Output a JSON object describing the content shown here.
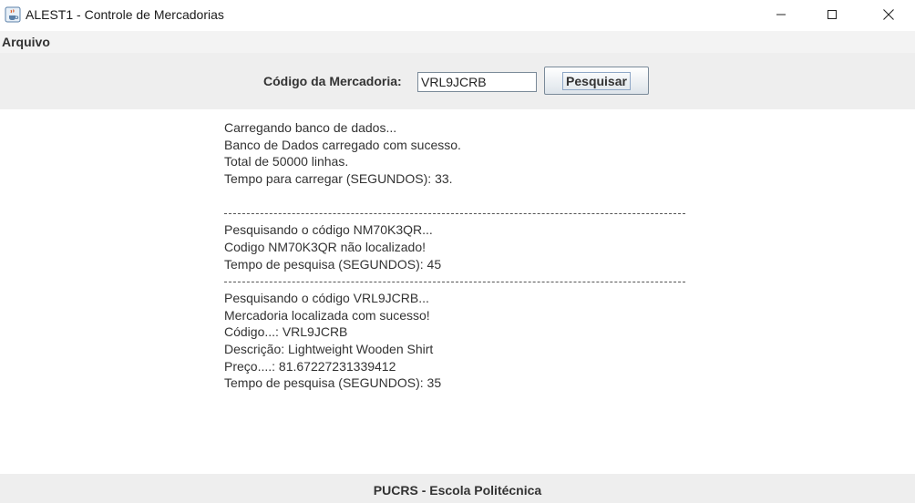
{
  "window": {
    "title": "ALEST1 - Controle de Mercadorias",
    "app_icon": "java-cup-icon"
  },
  "menu": {
    "items": [
      {
        "label": "Arquivo"
      }
    ]
  },
  "search": {
    "label": "Código da Mercadoria:",
    "value": "VRL9JCRB",
    "button_label": "Pesquisar"
  },
  "output": {
    "lines": [
      "Carregando banco de dados...",
      "Banco de Dados carregado com sucesso.",
      "Total de 50000 linhas.",
      "Tempo para carregar (SEGUNDOS): 33.",
      "Pesquisando o código NM70K3QR...",
      "Codigo NM70K3QR não localizado!",
      "Tempo de pesquisa (SEGUNDOS): 45",
      "Pesquisando o código VRL9JCRB...",
      "Mercadoria localizada com sucesso!",
      "Código...: VRL9JCRB",
      "Descrição: Lightweight Wooden Shirt",
      "Preço....: 81.67227231339412",
      "Tempo de pesquisa (SEGUNDOS): 35"
    ]
  },
  "footer": {
    "text": "PUCRS - Escola Politécnica"
  },
  "colors": {
    "toolbar_bg": "#eeeeee",
    "menubar_bg": "#f3f3f3",
    "text": "#333333"
  }
}
